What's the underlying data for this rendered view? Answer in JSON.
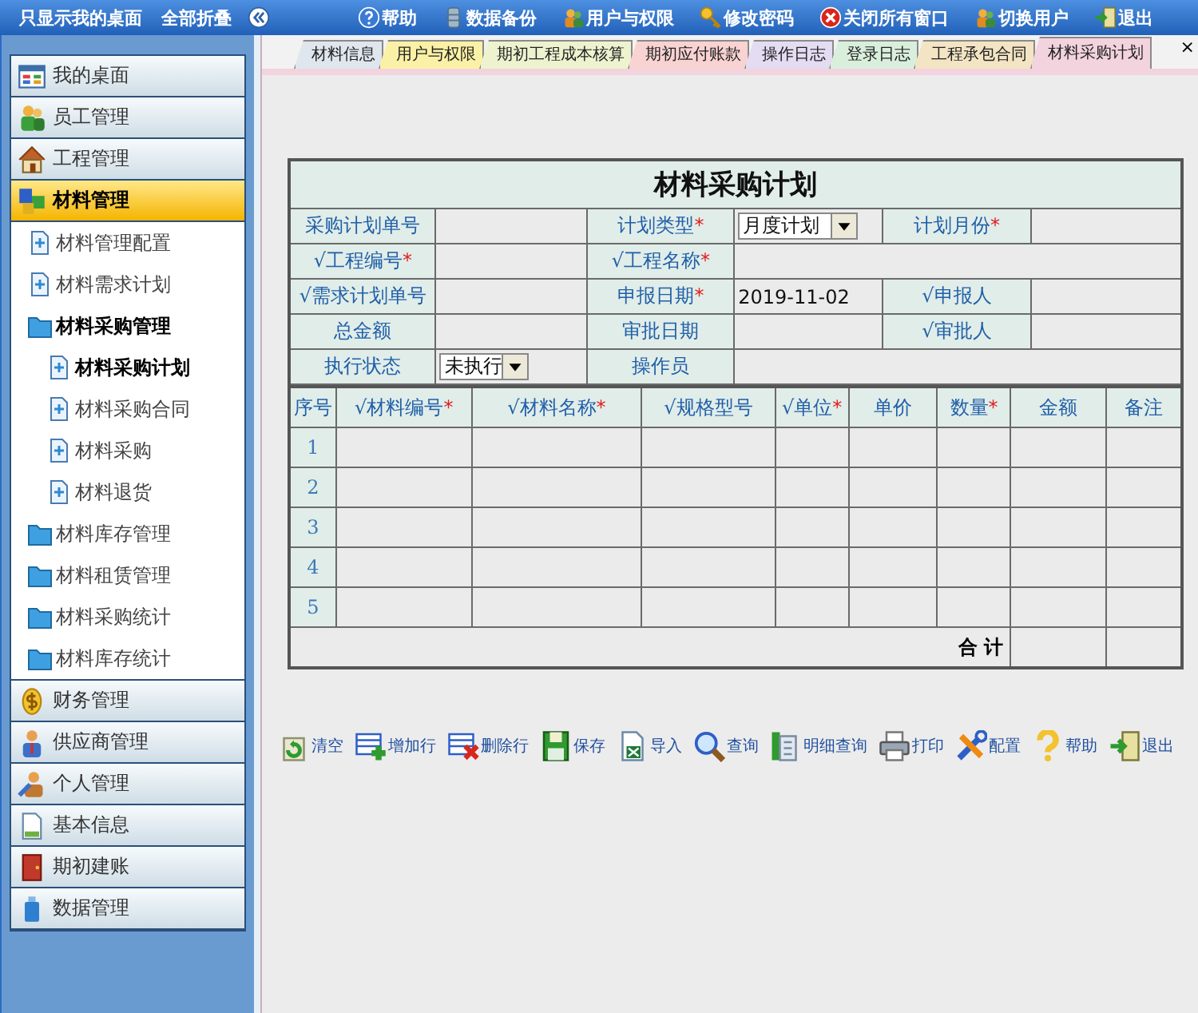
{
  "topbar": {
    "links": [
      "只显示我的桌面",
      "全部折叠"
    ],
    "actions": [
      "帮助",
      "数据备份",
      "用户与权限",
      "修改密码",
      "关闭所有窗口",
      "切换用户",
      "退出"
    ]
  },
  "sidebar": {
    "sections": [
      {
        "label": "我的桌面",
        "selected": false
      },
      {
        "label": "员工管理",
        "selected": false
      },
      {
        "label": "工程管理",
        "selected": false
      },
      {
        "label": "材料管理",
        "selected": true,
        "children": [
          {
            "label": "材料管理配置",
            "kind": "doc",
            "selected": false
          },
          {
            "label": "材料需求计划",
            "kind": "doc",
            "selected": false
          },
          {
            "label": "材料采购管理",
            "kind": "folder",
            "selected": false,
            "expanded": true,
            "children": [
              {
                "label": "材料采购计划",
                "kind": "doc",
                "selected": true
              },
              {
                "label": "材料采购合同",
                "kind": "doc",
                "selected": false
              },
              {
                "label": "材料采购",
                "kind": "doc",
                "selected": false
              },
              {
                "label": "材料退货",
                "kind": "doc",
                "selected": false
              }
            ]
          },
          {
            "label": "材料库存管理",
            "kind": "folder",
            "selected": false,
            "expanded": false
          },
          {
            "label": "材料租赁管理",
            "kind": "folder",
            "selected": false,
            "expanded": false
          },
          {
            "label": "材料采购统计",
            "kind": "folder",
            "selected": false,
            "expanded": false
          },
          {
            "label": "材料库存统计",
            "kind": "folder",
            "selected": false,
            "expanded": false
          }
        ]
      },
      {
        "label": "财务管理",
        "selected": false
      },
      {
        "label": "供应商管理",
        "selected": false
      },
      {
        "label": "个人管理",
        "selected": false
      },
      {
        "label": "基本信息",
        "selected": false
      },
      {
        "label": "期初建账",
        "selected": false
      },
      {
        "label": "数据管理",
        "selected": false
      }
    ]
  },
  "tabs": [
    {
      "label": "材料信息",
      "color": "#dfe6ee",
      "selected": false
    },
    {
      "label": "用户与权限",
      "color": "#fbf1a6",
      "selected": false
    },
    {
      "label": "期初工程成本核算",
      "color": "#eef3cf",
      "selected": false
    },
    {
      "label": "期初应付账款",
      "color": "#f9d2d2",
      "selected": false
    },
    {
      "label": "操作日志",
      "color": "#e3dcf2",
      "selected": false
    },
    {
      "label": "登录日志",
      "color": "#d9efdc",
      "selected": false
    },
    {
      "label": "工程承包合同",
      "color": "#f3e4c4",
      "selected": false
    },
    {
      "label": "材料采购计划",
      "color": "#f2d3de",
      "selected": true
    }
  ],
  "tab_close": "×",
  "form": {
    "title": "材料采购计划",
    "rows": [
      [
        {
          "kind": "label",
          "text": "采购计划单号"
        },
        {
          "kind": "value"
        },
        {
          "kind": "label",
          "text": "计划类型",
          "mark": "*"
        },
        {
          "kind": "select",
          "text": "月度计划"
        },
        {
          "kind": "label",
          "text": "计划月份",
          "mark": "*"
        },
        {
          "kind": "value"
        }
      ],
      [
        {
          "kind": "label",
          "text": "√工程编号",
          "mark": "*"
        },
        {
          "kind": "value"
        },
        {
          "kind": "label",
          "text": "√工程名称",
          "mark": "*"
        },
        {
          "kind": "wide"
        }
      ],
      [
        {
          "kind": "label",
          "text": "√需求计划单号"
        },
        {
          "kind": "value"
        },
        {
          "kind": "label",
          "text": "申报日期",
          "mark": "*"
        },
        {
          "kind": "value",
          "text": "2019-11-02"
        },
        {
          "kind": "label",
          "text": "√申报人"
        },
        {
          "kind": "value"
        }
      ],
      [
        {
          "kind": "label",
          "text": "总金额"
        },
        {
          "kind": "value"
        },
        {
          "kind": "label",
          "text": "审批日期"
        },
        {
          "kind": "value"
        },
        {
          "kind": "label",
          "text": "√审批人"
        },
        {
          "kind": "value"
        }
      ],
      [
        {
          "kind": "label",
          "text": "执行状态"
        },
        {
          "kind": "select",
          "text": "未执行"
        },
        {
          "kind": "label",
          "text": "操作员"
        },
        {
          "kind": "wide"
        }
      ]
    ]
  },
  "items": {
    "columns": [
      {
        "label": "序号"
      },
      {
        "label": "√材料编号",
        "mark": "*"
      },
      {
        "label": "√材料名称",
        "mark": "*"
      },
      {
        "label": "√规格型号"
      },
      {
        "label": "√单位",
        "mark": "*"
      },
      {
        "label": "单价"
      },
      {
        "label": "数量",
        "mark": "*"
      },
      {
        "label": "金额"
      },
      {
        "label": "备注"
      }
    ],
    "rows": [
      "1",
      "2",
      "3",
      "4",
      "5"
    ],
    "total_label": "合 计"
  },
  "toolbar": [
    "清空",
    "增加行",
    "删除行",
    "保存",
    "导入",
    "查询",
    "明细查询",
    "打印",
    "配置",
    "帮助",
    "退出"
  ]
}
